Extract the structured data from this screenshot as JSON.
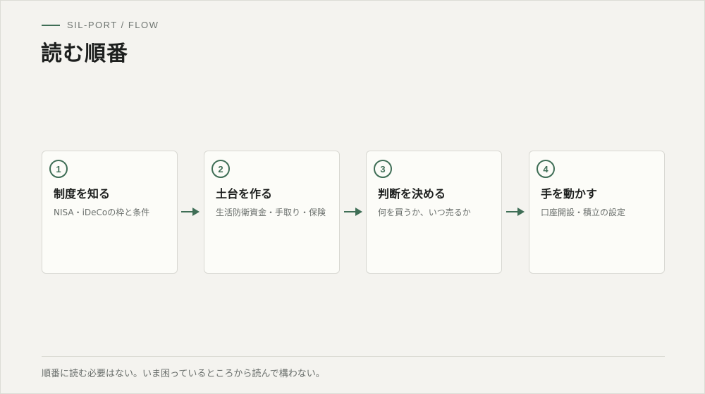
{
  "header": {
    "eyebrow": "SIL-PORT / FLOW",
    "title": "読む順番"
  },
  "steps": [
    {
      "number": "1",
      "title": "制度を知る",
      "description": "NISA・iDeCoの枠と条件"
    },
    {
      "number": "2",
      "title": "土台を作る",
      "description": "生活防衛資金・手取り・保険"
    },
    {
      "number": "3",
      "title": "判断を決める",
      "description": "何を買うか、いつ売るか"
    },
    {
      "number": "4",
      "title": "手を動かす",
      "description": "口座開設・積立の設定"
    }
  ],
  "footer": {
    "note": "順番に読む必要はない。いま困っているところから読んで構わない。"
  },
  "colors": {
    "accent": "#3f6e56",
    "background": "#f4f3ef",
    "card": "#fcfcf8"
  }
}
